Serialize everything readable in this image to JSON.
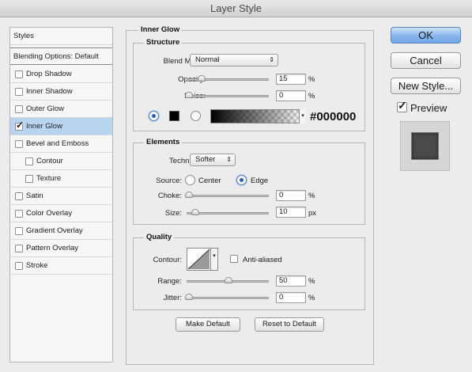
{
  "window": {
    "title": "Layer Style"
  },
  "styles_list": {
    "header": "Styles",
    "blending": "Blending Options: Default",
    "items": [
      {
        "label": "Drop Shadow",
        "checked": false
      },
      {
        "label": "Inner Shadow",
        "checked": false
      },
      {
        "label": "Outer Glow",
        "checked": false
      },
      {
        "label": "Inner Glow",
        "checked": true
      },
      {
        "label": "Bevel and Emboss",
        "checked": false
      },
      {
        "label": "Contour",
        "checked": false
      },
      {
        "label": "Texture",
        "checked": false
      },
      {
        "label": "Satin",
        "checked": false
      },
      {
        "label": "Color Overlay",
        "checked": false
      },
      {
        "label": "Gradient Overlay",
        "checked": false
      },
      {
        "label": "Pattern Overlay",
        "checked": false
      },
      {
        "label": "Stroke",
        "checked": false
      }
    ]
  },
  "inner_glow": {
    "title": "Inner Glow",
    "structure": {
      "title": "Structure",
      "blend_mode_label": "Blend Mode:",
      "blend_mode": "Normal",
      "opacity_label": "Opacity:",
      "opacity": "15",
      "noise_label": "Noise:",
      "noise": "0",
      "percent": "%",
      "hex": "#000000",
      "color_hex": "#000000"
    },
    "elements": {
      "title": "Elements",
      "technique_label": "Technique:",
      "technique": "Softer",
      "source_label": "Source:",
      "center": "Center",
      "edge": "Edge",
      "choke_label": "Choke:",
      "choke": "0",
      "size_label": "Size:",
      "size": "10",
      "px": "px",
      "percent": "%"
    },
    "quality": {
      "title": "Quality",
      "contour_label": "Contour:",
      "anti_aliased": "Anti-aliased",
      "range_label": "Range:",
      "range": "50",
      "jitter_label": "Jitter:",
      "jitter": "0",
      "percent": "%"
    },
    "make_default": "Make Default",
    "reset_default": "Reset to Default"
  },
  "buttons": {
    "ok": "OK",
    "cancel": "Cancel",
    "new_style": "New Style...",
    "preview": "Preview"
  }
}
